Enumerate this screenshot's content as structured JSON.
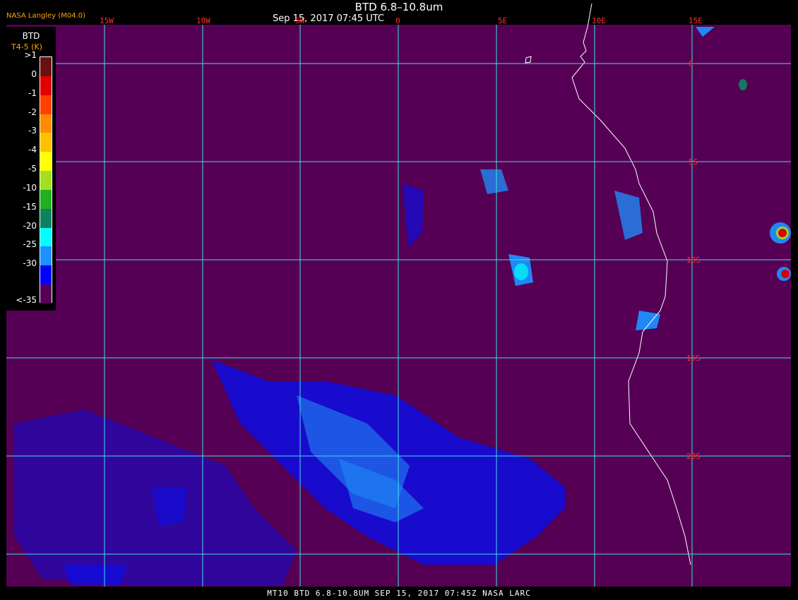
{
  "header": {
    "title": "BTD 6.8–10.8um",
    "timestamp": "Sep 15, 2017 07:45 UTC",
    "credit": "NASA Langley (M04.0)"
  },
  "longitude_labels": [
    "15W",
    "10W",
    "5W",
    "0",
    "5E",
    "10E",
    "15E"
  ],
  "latitude_labels": [
    "0",
    "5S",
    "10S",
    "15S",
    "20S"
  ],
  "legend": {
    "title": "BTD",
    "subtitle": "T4-5 (K)",
    "entries": [
      {
        "label": ">1",
        "color": "#6a1010"
      },
      {
        "label": "0",
        "color": "#e00000"
      },
      {
        "label": "-1",
        "color": "#ff4000"
      },
      {
        "label": "-2",
        "color": "#ff8c00"
      },
      {
        "label": "-3",
        "color": "#ffc000"
      },
      {
        "label": "-4",
        "color": "#ffff00"
      },
      {
        "label": "-5",
        "color": "#a0e020"
      },
      {
        "label": "-10",
        "color": "#20b020"
      },
      {
        "label": "-15",
        "color": "#108060"
      },
      {
        "label": "-20",
        "color": "#00ffff"
      },
      {
        "label": "-25",
        "color": "#1e90ff"
      },
      {
        "label": "-30",
        "color": "#0000ff"
      },
      {
        "label": "<-35",
        "color": "#550055"
      }
    ]
  },
  "footer": {
    "text": "MT10  BTD 6.8-10.8UM   SEP 15, 2017 07:45Z   NASA LARC"
  },
  "colors": {
    "background": "#550055",
    "gridline": "#40e0e0",
    "coastline": "#ffffff",
    "grid_label": "#ff3030"
  }
}
